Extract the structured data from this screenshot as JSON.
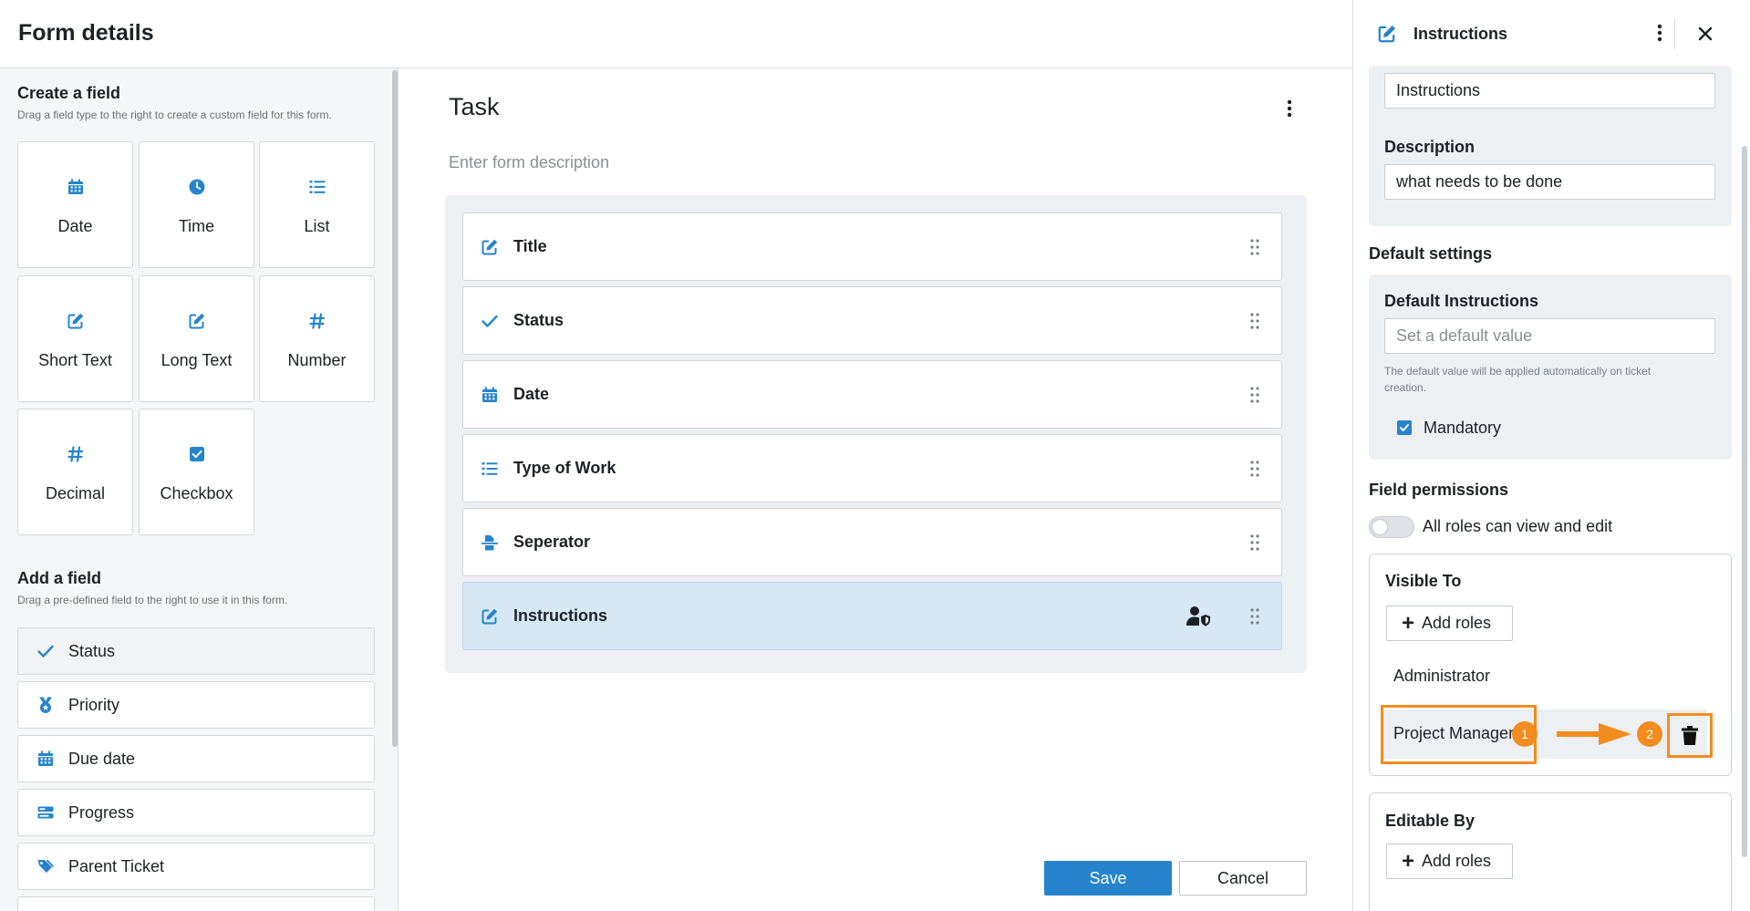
{
  "header": {
    "title": "Form details"
  },
  "create_field": {
    "title": "Create a field",
    "subtitle": "Drag a field type to the right to create a custom field for this form.",
    "tiles": [
      {
        "label": "Date",
        "icon": "calendar-icon"
      },
      {
        "label": "Time",
        "icon": "clock-icon"
      },
      {
        "label": "List",
        "icon": "list-icon"
      },
      {
        "label": "Short Text",
        "icon": "edit-icon"
      },
      {
        "label": "Long Text",
        "icon": "edit-icon"
      },
      {
        "label": "Number",
        "icon": "hash-icon"
      },
      {
        "label": "Decimal",
        "icon": "hash-icon"
      },
      {
        "label": "Checkbox",
        "icon": "checkbox-icon"
      }
    ]
  },
  "add_field": {
    "title": "Add a field",
    "subtitle": "Drag a pre-defined field to the right to use it in this form.",
    "items": [
      {
        "label": "Status",
        "icon": "check-icon"
      },
      {
        "label": "Priority",
        "icon": "medal-icon"
      },
      {
        "label": "Due date",
        "icon": "calendar-icon"
      },
      {
        "label": "Progress",
        "icon": "progress-icon"
      },
      {
        "label": "Parent Ticket",
        "icon": "tags-icon"
      }
    ]
  },
  "form": {
    "title": "Task",
    "description_placeholder": "Enter form description",
    "fields": [
      {
        "label": "Title",
        "icon": "edit-icon"
      },
      {
        "label": "Status",
        "icon": "check-icon"
      },
      {
        "label": "Date",
        "icon": "calendar-icon"
      },
      {
        "label": "Type of Work",
        "icon": "list-icon"
      },
      {
        "label": "Seperator",
        "icon": "separator-icon"
      },
      {
        "label": "Instructions",
        "icon": "edit-icon"
      }
    ],
    "save_label": "Save",
    "cancel_label": "Cancel"
  },
  "panel": {
    "title": "Instructions",
    "name_value": "Instructions",
    "description_label": "Description",
    "description_value": "what needs to be done",
    "default_settings_title": "Default settings",
    "default_instructions_label": "Default Instructions",
    "default_placeholder": "Set a default value",
    "default_hint": "The default value will be applied automatically on ticket creation.",
    "mandatory_label": "Mandatory",
    "field_permissions_title": "Field permissions",
    "toggle_label": "All roles can view and edit",
    "visible_to": {
      "title": "Visible To",
      "add_roles_label": "Add roles",
      "roles": [
        "Administrator",
        "Project Manager"
      ]
    },
    "editable_by": {
      "title": "Editable By",
      "add_roles_label": "Add roles"
    },
    "annotations": {
      "step1": "1",
      "step2": "2"
    }
  },
  "colors": {
    "accent": "#2584cc",
    "highlight": "#f28c1e",
    "active_row": "#d6e7f5"
  }
}
